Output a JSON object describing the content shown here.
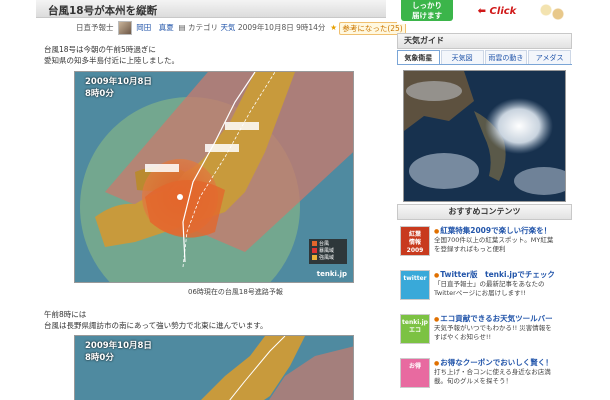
{
  "article": {
    "title": "台風18号が本州を縦断",
    "meta": {
      "role": "日直予報士",
      "author": "岡田　真夏",
      "category_label": "カテゴリ",
      "category": "天気",
      "datetime": "2009年10月8日 9時14分",
      "helpful": "参考になった(25)"
    },
    "paragraph1": [
      "台風18号は今朝の午前5時過ぎに",
      "愛知県の知多半島付近に上陸しました。"
    ],
    "map1": {
      "timestamp": [
        "2009年10月8日",
        "8時0分"
      ],
      "brand": "tenki.jp",
      "legend": [
        "台風",
        "暴風域",
        "強風域"
      ]
    },
    "caption1": "06時現在の台風18号進路予報",
    "paragraph2": [
      "午前8時には",
      "台風は長野県諏訪市の南にあって強い勢力で北東に進んでいます。"
    ],
    "map2": {
      "timestamp": [
        "2009年10月8日",
        "8時0分"
      ]
    }
  },
  "sidebar": {
    "banner": {
      "left_text": [
        "しっかり",
        "届けます"
      ],
      "click": "Click"
    },
    "weather_guide": {
      "title": "天気ガイド",
      "tabs": [
        "気象衛星",
        "天気図",
        "雨雲の動き",
        "アメダス"
      ],
      "active_tab": 0
    },
    "recommend": {
      "title": "おすすめコンテンツ",
      "items": [
        {
          "thumb": [
            "紅葉",
            "情報",
            "2009"
          ],
          "title": "紅葉特集2009で楽しい行楽を！",
          "text": [
            "全国700件以上の紅葉スポット。MY紅葉",
            "を登録すればもっと便利"
          ],
          "color": "#c83a1e"
        },
        {
          "thumb": [
            "twitter"
          ],
          "title": "Twitter版　tenki.jpでチェック",
          "text": [
            "「日直予報士」の最新記事をあなたの",
            "Twitterページにお届けします!!"
          ],
          "color": "#39a9d9"
        },
        {
          "thumb": [
            "tenki.jp",
            "エコ"
          ],
          "title": "エコ貢献できるお天気ツールバー",
          "text": [
            "天気予報がいつでもわかる!! 災害情報を",
            "すばやくお知らせ!!"
          ],
          "color": "#7cc243"
        },
        {
          "thumb": [
            "お得"
          ],
          "title": "お得なクーポンでおいしく賢く！",
          "text": [
            "打ち上げ・合コンに使える身近なお店満",
            "載。旬のグルメを探そう！"
          ],
          "color": "#e86aa0"
        }
      ]
    }
  }
}
